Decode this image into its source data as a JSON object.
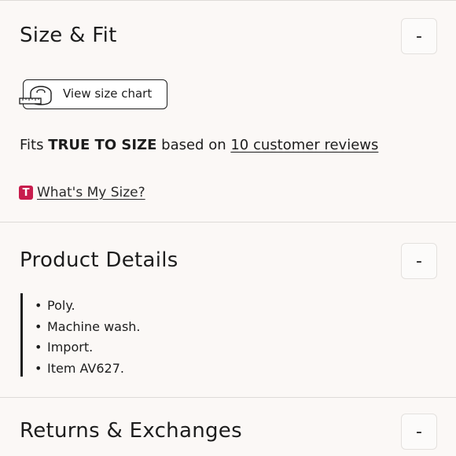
{
  "size_fit": {
    "title": "Size & Fit",
    "toggle": "-",
    "size_chart_label": "View size chart",
    "fits_prefix": "Fits",
    "fits_value": "TRUE TO SIZE",
    "fits_middle": "based on",
    "reviews_link": "10 customer reviews",
    "badge_letter": "T",
    "whats_my_size": "What's My Size?"
  },
  "product_details": {
    "title": "Product Details",
    "toggle": "-",
    "items": [
      "Poly.",
      "Machine wash.",
      "Import.",
      "Item AV627."
    ]
  },
  "returns": {
    "title": "Returns & Exchanges",
    "toggle": "-"
  },
  "colors": {
    "background": "#fbf8f6",
    "badge": "#c81d4d",
    "text": "#1d1d1d"
  }
}
